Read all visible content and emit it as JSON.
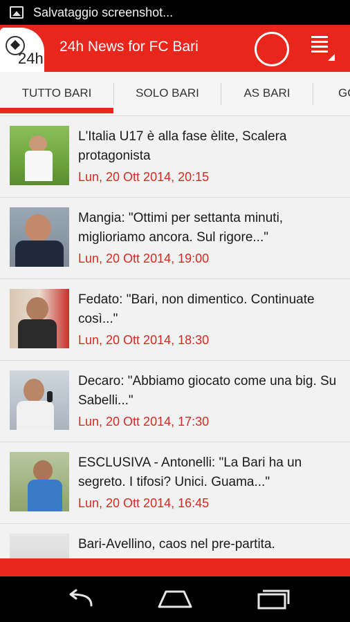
{
  "status_bar": {
    "notification_text": "Salvataggio screenshot..."
  },
  "app_bar": {
    "logo_text": "24h",
    "title": "24h News for FC Bari"
  },
  "tabs": [
    {
      "label": "TUTTO BARI",
      "selected": true
    },
    {
      "label": "SOLO BARI",
      "selected": false
    },
    {
      "label": "AS BARI",
      "selected": false
    },
    {
      "label": "GO",
      "selected": false
    }
  ],
  "news": [
    {
      "title": "L'Italia U17 è alla fase èlite, Scalera protagonista",
      "date": "Lun, 20 Ott 2014, 20:15"
    },
    {
      "title": "Mangia: \"Ottimi per settanta minuti, miglioriamo ancora. Sul rigore...\"",
      "date": "Lun, 20 Ott 2014, 19:00"
    },
    {
      "title": "Fedato: \"Bari, non dimentico. Continuate così...\"",
      "date": "Lun, 20 Ott 2014, 18:30"
    },
    {
      "title": "Decaro: \"Abbiamo giocato come una big. Su Sabelli...\"",
      "date": "Lun, 20 Ott 2014, 17:30"
    },
    {
      "title": "ESCLUSIVA - Antonelli: \"La Bari ha un segreto. I tifosi? Unici. Guama...\"",
      "date": "Lun, 20 Ott 2014, 16:45"
    },
    {
      "title": "Bari-Avellino, caos nel pre-partita.",
      "date": ""
    }
  ],
  "colors": {
    "accent": "#e8261c",
    "date_text": "#d42a20"
  },
  "icons": [
    "screenshot-notification-icon",
    "refresh-spinner-icon",
    "menu-icon",
    "back-icon",
    "home-icon",
    "recents-icon"
  ]
}
